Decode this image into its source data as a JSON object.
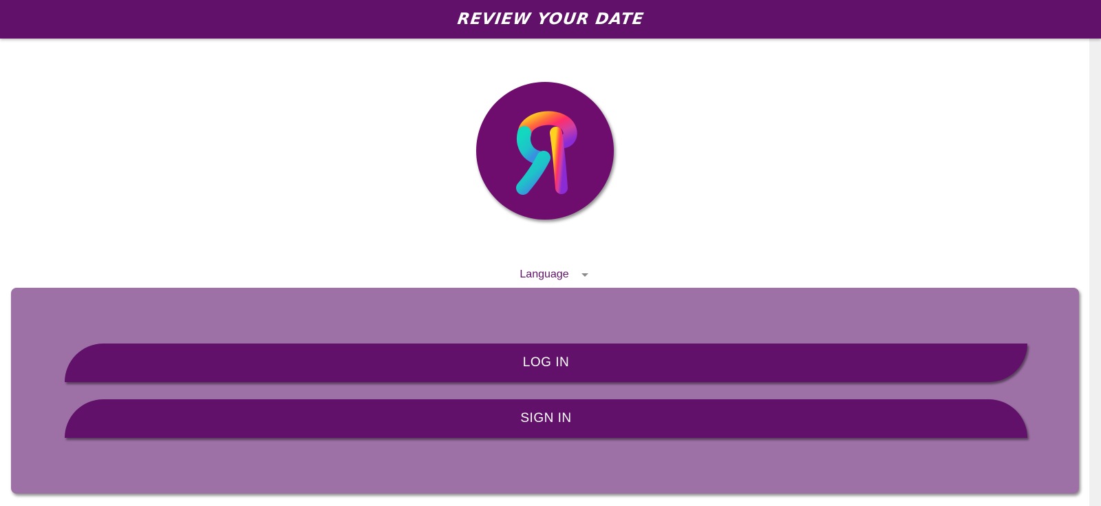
{
  "header": {
    "title": "REVIEW YOUR DATE"
  },
  "logo": {
    "letter": "R",
    "icon": "app-logo-icon"
  },
  "language": {
    "label": "Language",
    "icon": "chevron-down-icon"
  },
  "auth": {
    "login_label": "LOG IN",
    "signin_label": "SIGN IN"
  },
  "colors": {
    "primary": "#611169",
    "panel": "#9e71a6",
    "logo_bg": "#6f0d6f"
  }
}
